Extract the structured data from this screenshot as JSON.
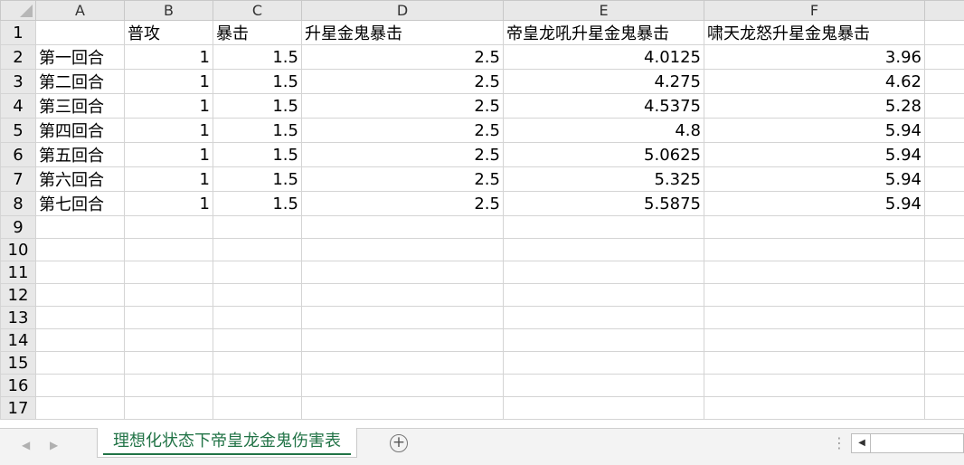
{
  "columns": [
    "A",
    "B",
    "C",
    "D",
    "E",
    "F"
  ],
  "header_row": {
    "num": "1",
    "A": "",
    "B": "普攻",
    "C": "暴击",
    "D": "升星金鬼暴击",
    "E": "帝皇龙吼升星金鬼暴击",
    "F": "啸天龙怒升星金鬼暴击"
  },
  "rows": [
    {
      "num": "2",
      "A": "第一回合",
      "B": "1",
      "C": "1.5",
      "D": "2.5",
      "E": "4.0125",
      "F": "3.96"
    },
    {
      "num": "3",
      "A": "第二回合",
      "B": "1",
      "C": "1.5",
      "D": "2.5",
      "E": "4.275",
      "F": "4.62"
    },
    {
      "num": "4",
      "A": "第三回合",
      "B": "1",
      "C": "1.5",
      "D": "2.5",
      "E": "4.5375",
      "F": "5.28"
    },
    {
      "num": "5",
      "A": "第四回合",
      "B": "1",
      "C": "1.5",
      "D": "2.5",
      "E": "4.8",
      "F": "5.94"
    },
    {
      "num": "6",
      "A": "第五回合",
      "B": "1",
      "C": "1.5",
      "D": "2.5",
      "E": "5.0625",
      "F": "5.94"
    },
    {
      "num": "7",
      "A": "第六回合",
      "B": "1",
      "C": "1.5",
      "D": "2.5",
      "E": "5.325",
      "F": "5.94"
    },
    {
      "num": "8",
      "A": "第七回合",
      "B": "1",
      "C": "1.5",
      "D": "2.5",
      "E": "5.5875",
      "F": "5.94"
    }
  ],
  "empty_rows": [
    "9",
    "10",
    "11",
    "12",
    "13",
    "14",
    "15",
    "16",
    "17"
  ],
  "sheet_tab": "理想化状态下帝皇龙金鬼伤害表",
  "accent_color": "#217346",
  "icons": {
    "add_sheet": "plus-circle-icon",
    "nav_prev": "chevron-left-icon",
    "nav_next": "chevron-right-icon",
    "options": "vertical-ellipsis-icon",
    "scroll_left": "scroll-left-arrow-icon"
  }
}
